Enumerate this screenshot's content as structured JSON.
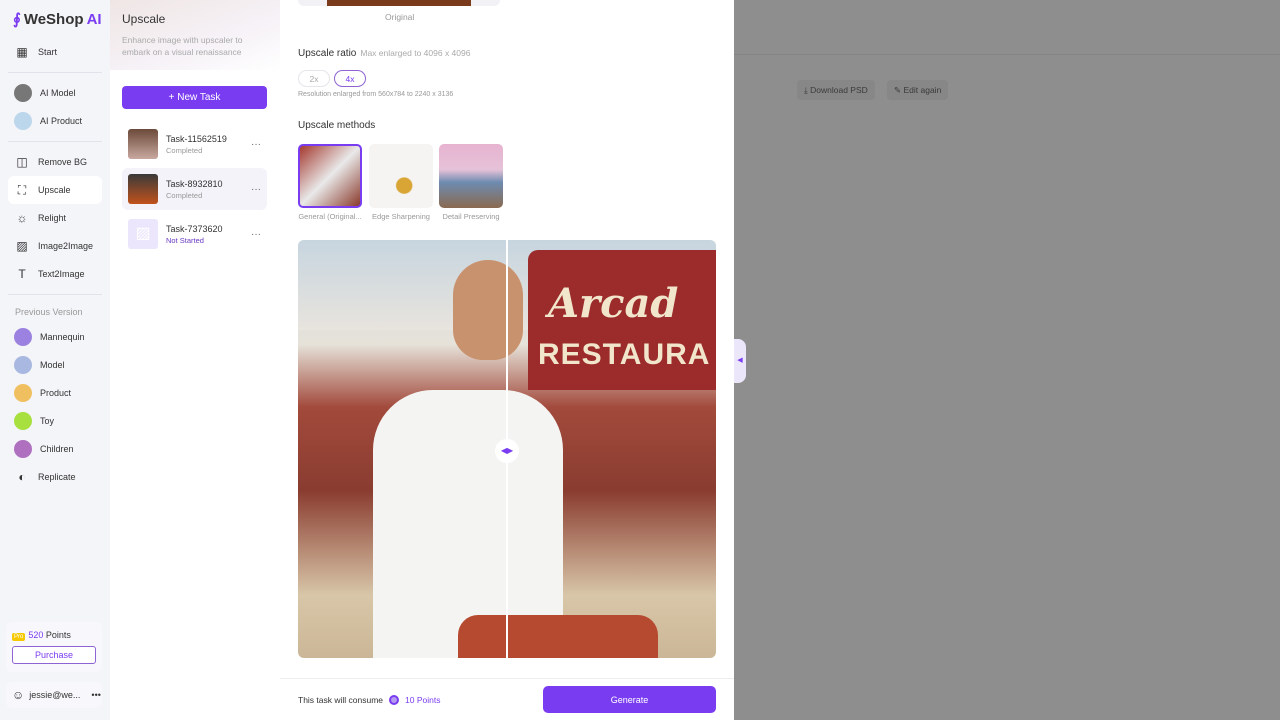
{
  "brand": {
    "name": "WeShop",
    "suffix": "AI",
    "accent": "#7a3cf0"
  },
  "nav": {
    "items": [
      {
        "label": "Start",
        "icon": "grid-icon"
      },
      {
        "label": "AI Model",
        "icon": "avatar"
      },
      {
        "label": "AI Product",
        "icon": "avatar"
      },
      {
        "label": "Remove BG",
        "icon": "remove-bg-icon"
      },
      {
        "label": "Upscale",
        "icon": "upscale-icon",
        "active": true
      },
      {
        "label": "Relight",
        "icon": "relight-icon"
      },
      {
        "label": "Image2Image",
        "icon": "image-icon"
      },
      {
        "label": "Text2Image",
        "icon": "text-icon"
      }
    ],
    "section": "Previous Version",
    "previous": [
      {
        "label": "Mannequin"
      },
      {
        "label": "Model"
      },
      {
        "label": "Product"
      },
      {
        "label": "Toy"
      },
      {
        "label": "Children"
      },
      {
        "label": "Replicate"
      }
    ],
    "pro_badge": "Pro",
    "points_value": "520",
    "points_label": "Points",
    "purchase": "Purchase",
    "user": "jessie@we...",
    "user_more": "•••"
  },
  "tasks": {
    "title": "Upscale",
    "subtitle": "Enhance image with upscaler to embark on a visual renaissance",
    "new_task": "New Task",
    "list": [
      {
        "name": "Task-11562519",
        "status": "Completed"
      },
      {
        "name": "Task-8932810",
        "status": "Completed"
      },
      {
        "name": "Task-7373620",
        "status": "Not Started"
      }
    ]
  },
  "main": {
    "original_label": "Original",
    "ratio_title": "Upscale ratio",
    "ratio_hint": "Max enlarged to 4096 x 4096",
    "ratios": [
      "2x",
      "4x"
    ],
    "selected_ratio": "4x",
    "resolution": "Resolution enlarged from 560x784 to 2240 x 3136",
    "methods_title": "Upscale methods",
    "methods": [
      "General (Original...",
      "Edge Sharpening",
      "Detail Preserving"
    ],
    "preview": {
      "sign_top": "Arcad",
      "sign_bottom": "RESTAURA"
    },
    "consume_label": "This task will consume",
    "consume_points": "10 Points",
    "generate": "Generate"
  },
  "overlay": {
    "download_psd": "Download PSD",
    "edit_again": "Edit again"
  }
}
